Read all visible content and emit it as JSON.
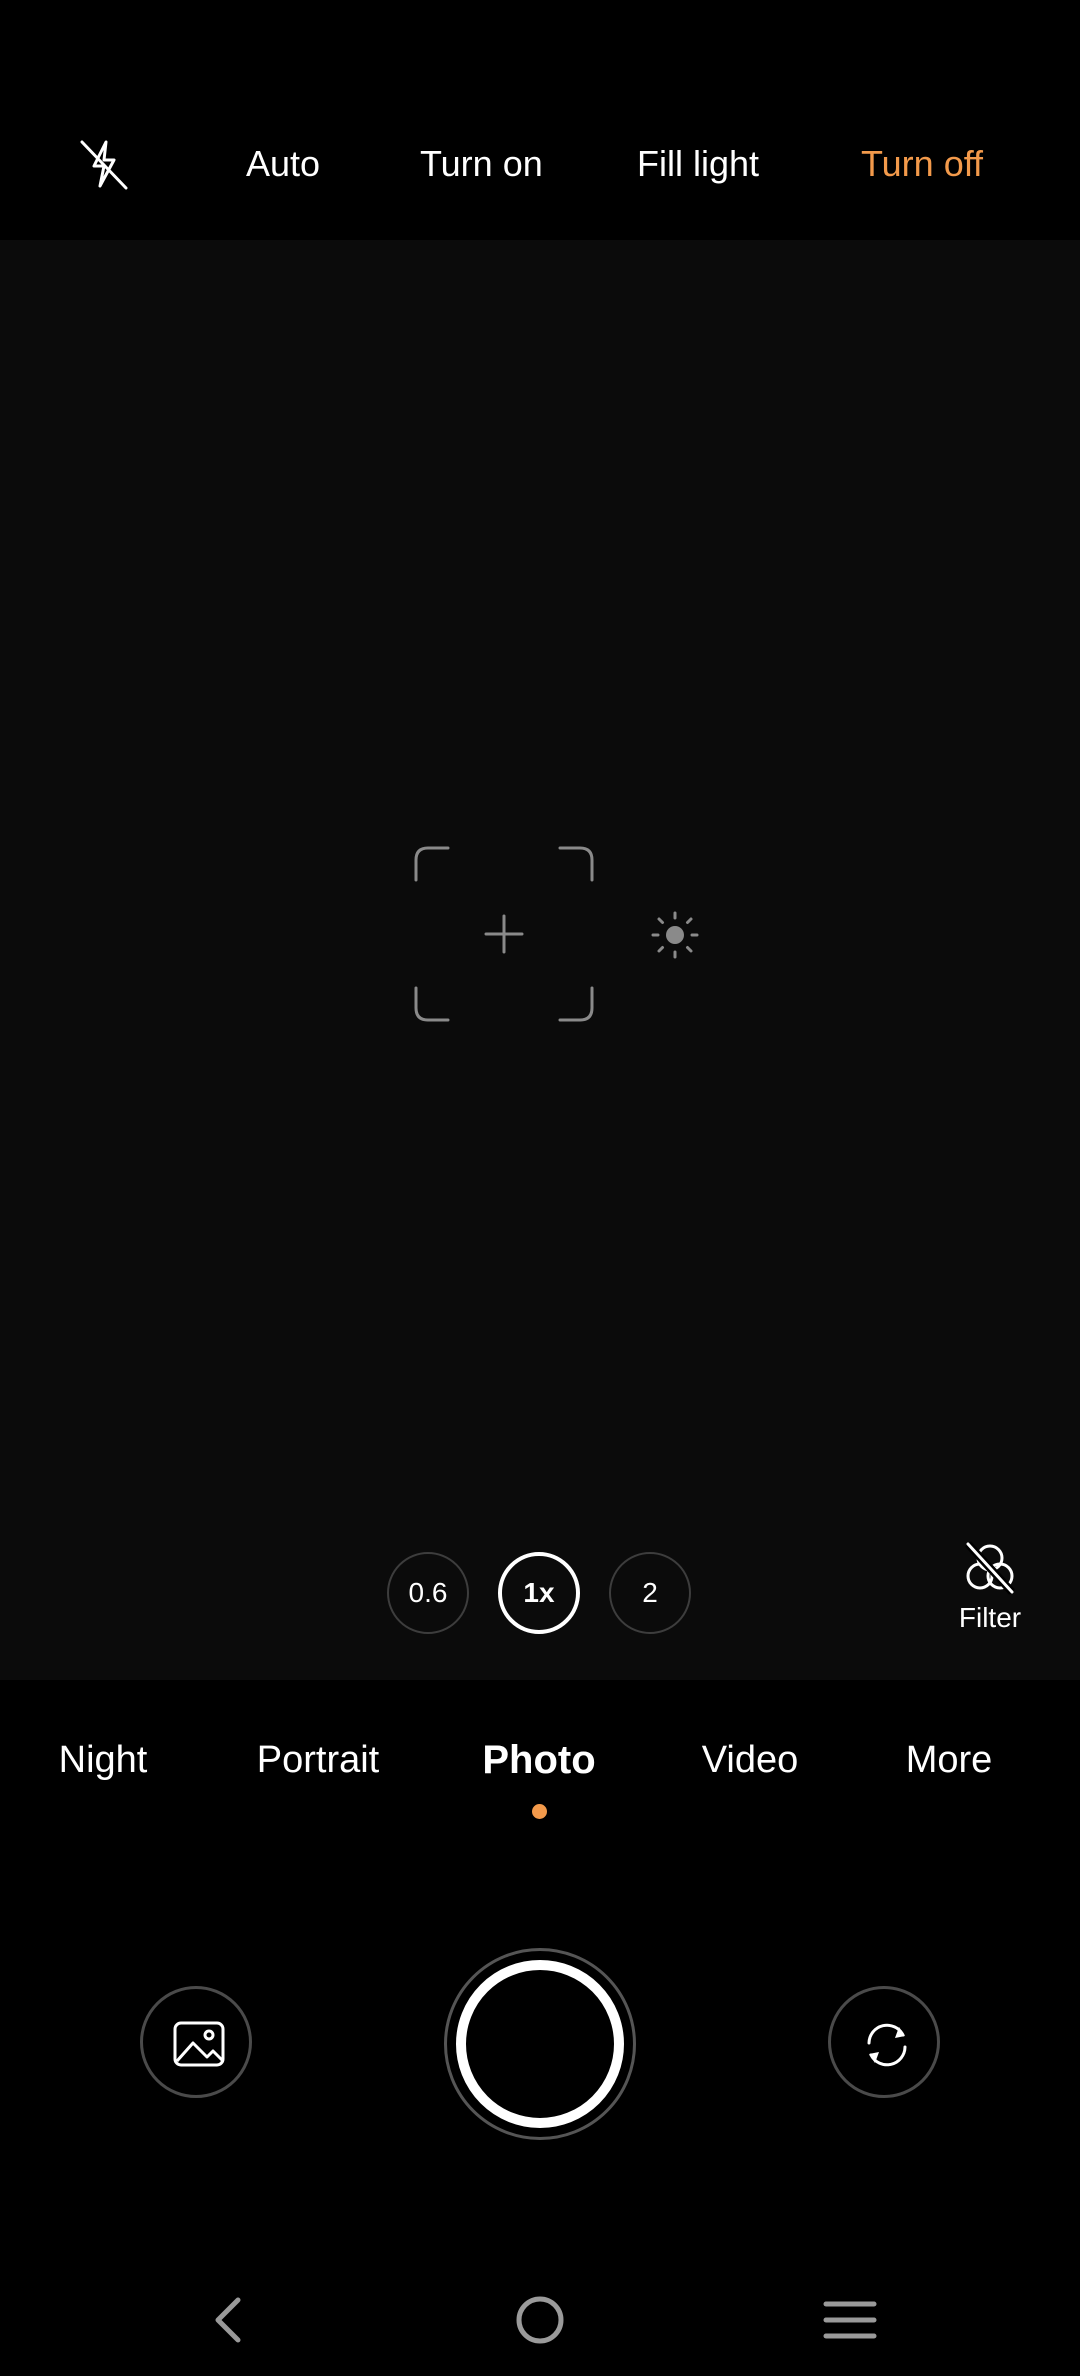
{
  "flash": {
    "icon": "flash-off-icon",
    "options": [
      "Auto",
      "Turn on",
      "Fill light",
      "Turn off"
    ],
    "active_option": "Turn off",
    "active_color": "#F39A4B"
  },
  "viewfinder": {
    "focus_icon": "focus-frame-icon",
    "exposure_icon": "exposure-sun-icon"
  },
  "zoom": {
    "levels": [
      "0.6",
      "1x",
      "2"
    ],
    "active": "1x"
  },
  "filter": {
    "icon": "filter-off-icon",
    "label": "Filter"
  },
  "modes": {
    "items": [
      "Night",
      "Portrait",
      "Photo",
      "Video",
      "More"
    ],
    "active": "Photo",
    "indicator_color": "#F39A4B"
  },
  "controls": {
    "gallery_icon": "gallery-icon",
    "shutter": "shutter-button",
    "switch_icon": "switch-camera-icon"
  },
  "nav": {
    "back_icon": "back-icon",
    "home_icon": "home-icon",
    "menu_icon": "menu-icon"
  }
}
